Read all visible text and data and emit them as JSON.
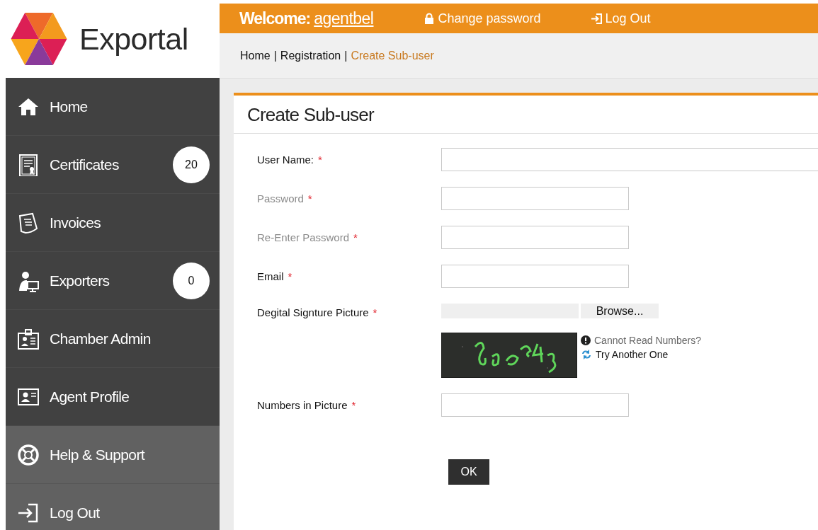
{
  "logo": {
    "text": "Exportal"
  },
  "header": {
    "welcome_label": "Welcome:",
    "username": "agentbel",
    "links": [
      {
        "kind": "password",
        "label": "Change password"
      },
      {
        "kind": "logout",
        "label": "Log Out"
      }
    ]
  },
  "breadcrumb": {
    "separator": "|",
    "items": [
      {
        "label": "Home",
        "current": false
      },
      {
        "label": "Registration",
        "current": false
      },
      {
        "label": "Create Sub-user",
        "current": true
      }
    ]
  },
  "sidebar": {
    "items": [
      {
        "kind": "home",
        "label": "Home",
        "highlighted": false
      },
      {
        "kind": "certificate",
        "label": "Certificates",
        "badge": "20",
        "highlighted": false
      },
      {
        "kind": "invoice",
        "label": "Invoices",
        "highlighted": false
      },
      {
        "kind": "exporter",
        "label": "Exporters",
        "badge": "0",
        "highlighted": false
      },
      {
        "kind": "badge-card",
        "label": "Chamber Admin",
        "highlighted": false
      },
      {
        "kind": "profile",
        "label": "Agent Profile",
        "highlighted": false
      },
      {
        "kind": "help",
        "label": "Help & Support",
        "highlighted": true
      },
      {
        "kind": "logout",
        "label": "Log Out",
        "highlighted": true
      }
    ]
  },
  "panel": {
    "title": "Create Sub-user",
    "fields": [
      {
        "kind": "long-text",
        "label": "User Name:",
        "required_mark": "*",
        "greyed": false
      },
      {
        "kind": "text",
        "label": "Password",
        "required_mark": "*",
        "greyed": true
      },
      {
        "kind": "text",
        "label": "Re-Enter Password",
        "required_mark": "*",
        "greyed": true
      },
      {
        "kind": "text",
        "label": "Email",
        "required_mark": "*",
        "greyed": false
      },
      {
        "kind": "file",
        "label": "Degital Signture Picture",
        "required_mark": "*",
        "greyed": false,
        "button": "Browse..."
      },
      {
        "kind": "captcha",
        "help_link": "Cannot Read Numbers?",
        "refresh_link": "Try Another One"
      },
      {
        "kind": "text",
        "label": "Numbers in Picture",
        "required_mark": "*",
        "greyed": false
      }
    ],
    "submit": "OK"
  }
}
